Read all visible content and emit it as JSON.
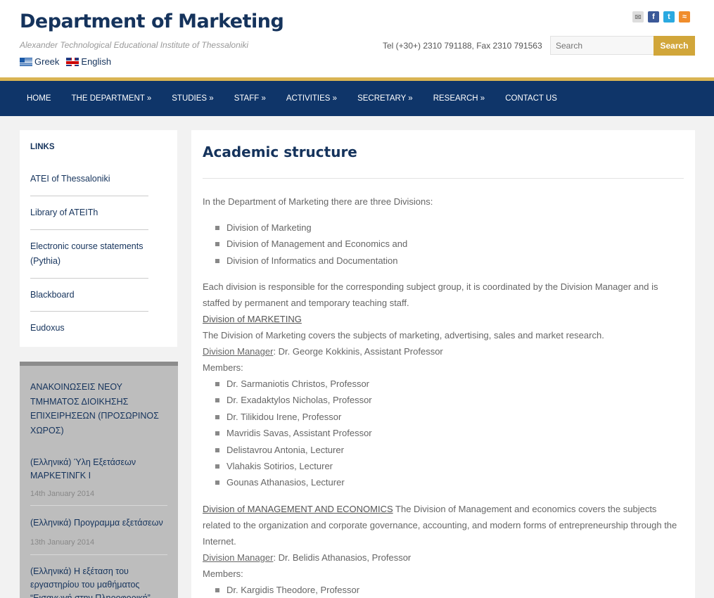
{
  "header": {
    "title": "Department of Marketing",
    "subtitle": "Alexander Technological Educational Institute of Thessaloniki",
    "languages": [
      "Greek",
      "English"
    ],
    "phone": "Tel (+30+)  2310 791188, Fax 2310 791563",
    "search_placeholder": "Search",
    "search_button": "Search",
    "social_icons": [
      "mail-icon",
      "facebook-icon",
      "twitter-icon",
      "rss-icon"
    ]
  },
  "colors": {
    "brand": "#0f3569",
    "accent": "#d1a63a"
  },
  "nav": [
    "HOME",
    "THE DEPARTMENT »",
    "STUDIES »",
    "STAFF »",
    "ACTIVITIES »",
    "SECRETARY »",
    "RESEARCH »",
    "CONTACT US"
  ],
  "sidebar": {
    "links_title": "LINKS",
    "links": [
      "ATEI of Thessaloniki",
      "Library of ATEITh",
      "Electronic course statements (Pythia)",
      "Blackboard",
      "Eudoxus"
    ],
    "news_title": "ΑΝΑΚΟΙΝΩΣΕΙΣ ΝΕΟΥ ΤΜΗΜΑΤΟΣ ΔΙΟΙΚΗΣΗΣ ΕΠΙΧΕΙΡΗΣΕΩΝ (ΠΡΟΣΩΡΙΝΟΣ ΧΩΡΟΣ)",
    "news": [
      {
        "title": "(Ελληνικά) Ύλη Εξετάσεων ΜΑΡΚΕΤΙΝΓΚ Ι",
        "date": "14th January 2014"
      },
      {
        "title": "(Ελληνικά) Προγραμμα εξετάσεων",
        "date": "13th January 2014"
      },
      {
        "title": "(Ελληνικά) Η εξέταση του εργαστηρίου του μαθήματος “Εισαγωγή στην Πληροφορική”",
        "date": ""
      }
    ]
  },
  "main": {
    "title": "Academic structure",
    "intro": "In the Department of Marketing there are three Divisions:",
    "divisions": [
      "Division of Marketing",
      "Division of Management and Economics and",
      "Division of Informatics and Documentation"
    ],
    "para1": "Each division is responsible for the corresponding subject group, it is coordinated by the Division Manager and is staffed by permanent and temporary teaching staff.",
    "marketing_heading": "Division of MARKETING",
    "marketing_desc": "The Division of Marketing covers the subjects of marketing, advertising, sales and market research.",
    "manager_label": "Division Manager",
    "marketing_manager": ": Dr. George Kokkinis, Assistant Professor",
    "members_label": "Members:",
    "marketing_members": [
      "Dr. Sarmaniotis Christos, Professor",
      "Dr. Exadaktylos Nicholas, Professor",
      "Dr. Tilikidou Irene, Professor",
      "Mavridis Savas, Assistant Professor",
      "Delistavrou Antonia, Lecturer",
      "Vlahakis Sotirios, Lecturer",
      "Gounas Athanasios, Lecturer"
    ],
    "mgmt_heading": "Division of MANAGEMENT AND ECONOMICS",
    "mgmt_desc": " The Division of Management and economics covers the subjects related to the organization and corporate governance, accounting, and modern forms of entrepreneurship through the Internet.",
    "mgmt_manager": ": Dr. Belidis Athanasios, Professor",
    "mgmt_members": [
      "Dr. Kargidis Theodore, Professor"
    ]
  }
}
